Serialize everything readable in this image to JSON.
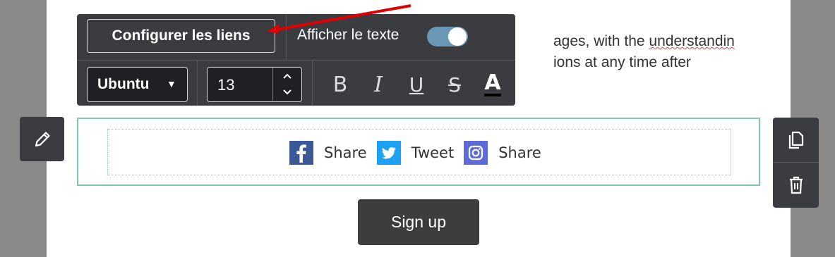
{
  "content": {
    "body_text": {
      "line1_prefix": "ages, with the ",
      "line1_misspelled": "understandin",
      "line2": "ions at any time after"
    }
  },
  "toolbar": {
    "configure_links_label": "Configurer les liens",
    "show_text_label": "Afficher le texte",
    "show_text_enabled": true,
    "font_family": "Ubuntu",
    "font_size": "13",
    "format_buttons": [
      "bold",
      "italic",
      "underline",
      "strikethrough",
      "text-color"
    ],
    "bold_glyph": "B",
    "italic_glyph": "I",
    "underline_glyph": "U",
    "strike_glyph": "S",
    "color_glyph": "A"
  },
  "social_share": {
    "items": [
      {
        "network": "facebook",
        "label": "Share",
        "icon": "facebook-icon",
        "color": "#3b5998"
      },
      {
        "network": "twitter",
        "label": "Tweet",
        "icon": "twitter-icon",
        "color": "#1da1f2"
      },
      {
        "network": "instagram",
        "label": "Share",
        "icon": "instagram-icon",
        "color": "#5c6bd9"
      }
    ]
  },
  "actions": {
    "signup_label": "Sign up"
  },
  "colors": {
    "toolbar_bg": "#3a3c40",
    "selection_border": "#7ec7b4",
    "toggle_on": "#6a97b5",
    "annotation_arrow": "#e00000"
  }
}
